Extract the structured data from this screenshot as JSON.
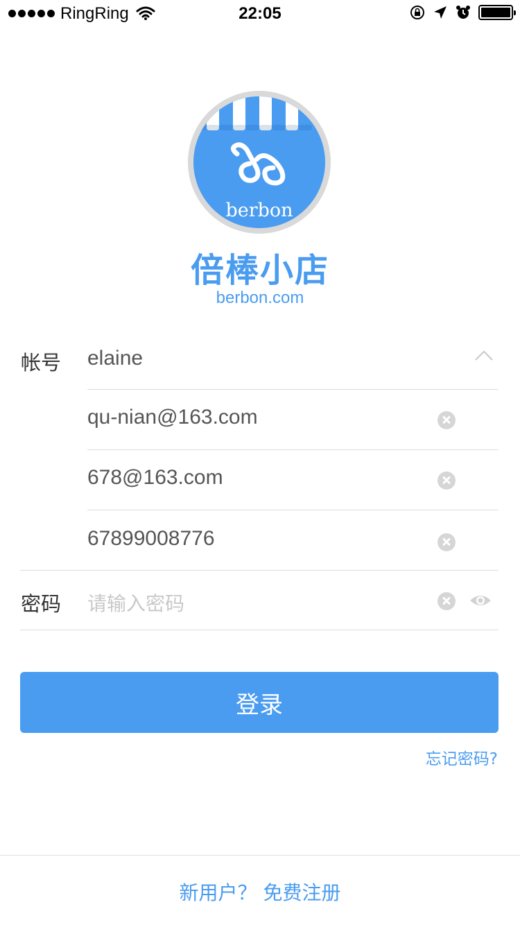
{
  "status_bar": {
    "carrier": "RingRing",
    "time": "22:05",
    "icons": [
      "signal-dots-icon",
      "wifi-icon",
      "rotation-lock-icon",
      "location-arrow-icon",
      "alarm-icon",
      "battery-icon"
    ]
  },
  "logo": {
    "logo_text": "berbon",
    "brand_name": "倍棒小店",
    "domain": "berbon.com",
    "colors": {
      "blue": "#4a9cf0",
      "ring": "#d9d9d9",
      "stripe": "#ffffff"
    }
  },
  "form": {
    "account_label": "帐号",
    "account_value": "elaine",
    "account_history": [
      {
        "value": "qu-nian@163.com"
      },
      {
        "value": "678@163.com"
      },
      {
        "value": "67899008776"
      }
    ],
    "password_label": "密码",
    "password_placeholder": "请输入密码",
    "icons": [
      "chevron-up-icon",
      "clear-icon",
      "eye-icon"
    ]
  },
  "actions": {
    "login_label": "登录",
    "forgot_password": "忘记密码?",
    "register": "新用户？ 免费注册"
  },
  "colors": {
    "accent": "#4a9cf0",
    "divider": "#dcdcdc",
    "placeholder": "#c8c8c8"
  }
}
